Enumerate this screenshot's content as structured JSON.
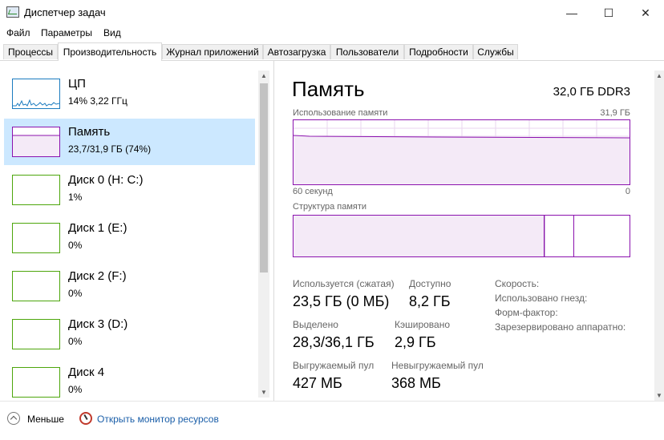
{
  "window": {
    "title": "Диспетчер задач",
    "minimize_glyph": "—",
    "maximize_glyph": "☐",
    "close_glyph": "✕"
  },
  "menu": [
    "Файл",
    "Параметры",
    "Вид"
  ],
  "tabs": [
    "Процессы",
    "Производительность",
    "Журнал приложений",
    "Автозагрузка",
    "Пользователи",
    "Подробности",
    "Службы"
  ],
  "active_tab": "Производительность",
  "sidebar": {
    "items": [
      {
        "name": "ЦП",
        "value": "14% 3,22 ГГц",
        "kind": "cpu",
        "color": "#1b7bbf"
      },
      {
        "name": "Память",
        "value": "23,7/31,9 ГБ (74%)",
        "kind": "memory",
        "color": "#8b12ae",
        "selected": true
      },
      {
        "name": "Диск 0 (H: C:)",
        "value": "1%",
        "kind": "disk",
        "color": "#4da60c"
      },
      {
        "name": "Диск 1 (E:)",
        "value": "0%",
        "kind": "disk",
        "color": "#4da60c"
      },
      {
        "name": "Диск 2 (F:)",
        "value": "0%",
        "kind": "disk",
        "color": "#4da60c"
      },
      {
        "name": "Диск 3 (D:)",
        "value": "0%",
        "kind": "disk",
        "color": "#4da60c"
      },
      {
        "name": "Диск 4",
        "value": "0%",
        "kind": "disk",
        "color": "#4da60c"
      }
    ]
  },
  "memory": {
    "title": "Память",
    "capacity": "32,0 ГБ DDR3",
    "usage_label": "Использование памяти",
    "usage_max": "31,9 ГБ",
    "time_left": "60 секунд",
    "time_right": "0",
    "composition_label": "Структура памяти",
    "accent": "#8b12ae",
    "in_use_label": "Используется (сжатая)",
    "in_use": "23,5 ГБ (0 МБ)",
    "available_label": "Доступно",
    "available": "8,2 ГБ",
    "committed_label": "Выделено",
    "committed": "28,3/36,1 ГБ",
    "cached_label": "Кэшировано",
    "cached": "2,9 ГБ",
    "paged_label": "Выгружаемый пул",
    "paged": "427 МБ",
    "nonpaged_label": "Невыгружаемый пул",
    "nonpaged": "368 МБ",
    "speed_label": "Скорость:",
    "slots_label": "Использовано гнезд:",
    "form_label": "Форм-фактор:",
    "reserved_label": "Зарезервировано аппаратно:",
    "usage_fraction": 0.74
  },
  "footer": {
    "fewer": "Меньше",
    "resmon": "Открыть монитор ресурсов"
  }
}
